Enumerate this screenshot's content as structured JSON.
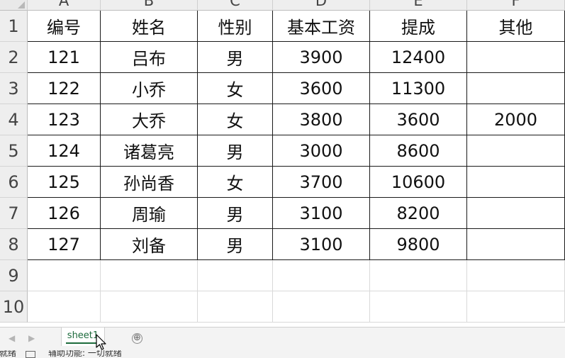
{
  "sheet": {
    "columns": [
      "A",
      "B",
      "C",
      "D",
      "E",
      "F"
    ],
    "rows": [
      "1",
      "2",
      "3",
      "4",
      "5",
      "6",
      "7",
      "8",
      "9",
      "10"
    ],
    "header": [
      "编号",
      "姓名",
      "性别",
      "基本工资",
      "提成",
      "其他"
    ],
    "data": [
      [
        "121",
        "吕布",
        "男",
        "3900",
        "12400",
        ""
      ],
      [
        "122",
        "小乔",
        "女",
        "3600",
        "11300",
        ""
      ],
      [
        "123",
        "大乔",
        "女",
        "3800",
        "3600",
        "2000"
      ],
      [
        "124",
        "诸葛亮",
        "男",
        "3000",
        "8600",
        ""
      ],
      [
        "125",
        "孙尚香",
        "女",
        "3700",
        "10600",
        ""
      ],
      [
        "126",
        "周瑜",
        "男",
        "3100",
        "8200",
        ""
      ],
      [
        "127",
        "刘备",
        "男",
        "3100",
        "9800",
        ""
      ]
    ]
  },
  "tabs": {
    "active": "sheet1",
    "add": "⊕"
  },
  "status": {
    "ready": "就绪",
    "accessibility": "辅助功能: 一切就绪"
  },
  "colors": {
    "accent": "#1d6b3c",
    "grid": "#d9d9d9",
    "border": "#1a1a1a"
  }
}
